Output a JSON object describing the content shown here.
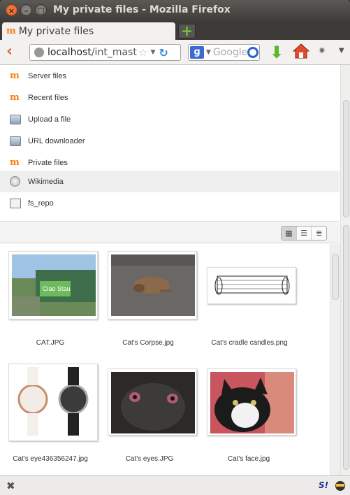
{
  "window": {
    "title": "My private files - Mozilla Firefox",
    "close_glyph": "×",
    "min_glyph": "–",
    "max_glyph": "□"
  },
  "tab": {
    "label": "My private files",
    "new_tab_glyph": "+"
  },
  "nav": {
    "back_glyph": "‹",
    "url_host": "localhost",
    "url_path": "/int_mast",
    "search_placeholder": "Google",
    "search_engine_letter": "g"
  },
  "repositories": [
    {
      "label": "Server files",
      "icon": "moodle-icon"
    },
    {
      "label": "Recent files",
      "icon": "moodle-icon"
    },
    {
      "label": "Upload a file",
      "icon": "upload-icon"
    },
    {
      "label": "URL downloader",
      "icon": "url-downloader-icon"
    },
    {
      "label": "Private files",
      "icon": "moodle-icon"
    },
    {
      "label": "Wikimedia",
      "icon": "wikimedia-icon",
      "active": true
    },
    {
      "label": "fs_repo",
      "icon": "filesystem-icon"
    }
  ],
  "view_modes": [
    {
      "name": "icons-view",
      "glyph": "▦",
      "selected": true
    },
    {
      "name": "list-view",
      "glyph": "☰"
    },
    {
      "name": "tree-view",
      "glyph": "≣"
    }
  ],
  "files": [
    {
      "name": "CAT.JPG"
    },
    {
      "name": "Cat's Corpse.jpg"
    },
    {
      "name": "Cat's cradle candles.png"
    },
    {
      "name": "Cat's eye436356247.jpg"
    },
    {
      "name": "Cat's eyes.JPG"
    },
    {
      "name": "Cat's face.jpg"
    }
  ],
  "status": {
    "close_glyph": "✖",
    "addon_label": "S!"
  },
  "colors": {
    "moodle_orange": "#f98012",
    "firefox_title_bg": "#3c3b37",
    "active_repo_bg": "#efefef"
  }
}
